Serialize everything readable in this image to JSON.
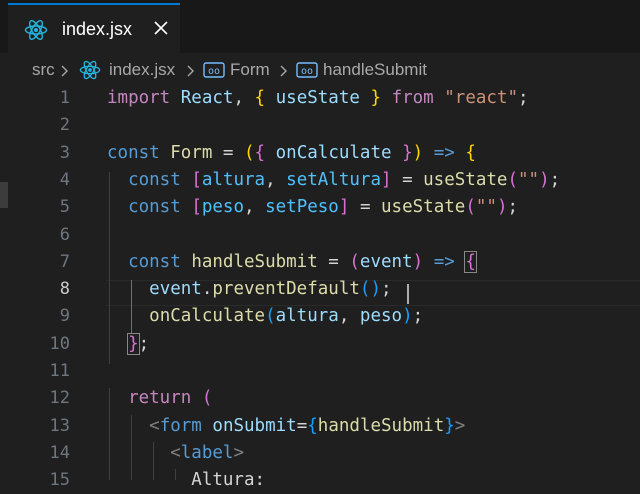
{
  "tab": {
    "filename": "index.jsx",
    "close_label": "close-tab"
  },
  "breadcrumb": {
    "root": "src",
    "file": "index.jsx",
    "component": "Form",
    "symbol": "handleSubmit"
  },
  "editor": {
    "active_line": 8,
    "line_numbers": [
      "1",
      "2",
      "3",
      "4",
      "5",
      "6",
      "7",
      "8",
      "9",
      "10",
      "11",
      "12",
      "13",
      "14",
      "15"
    ],
    "lines": [
      [
        [
          "kw2",
          "import"
        ],
        [
          "d",
          " "
        ],
        [
          "v",
          "React"
        ],
        [
          "d",
          ", "
        ],
        [
          "b1",
          "{"
        ],
        [
          "d",
          " "
        ],
        [
          "v",
          "useState"
        ],
        [
          "d",
          " "
        ],
        [
          "b1",
          "}"
        ],
        [
          "d",
          " "
        ],
        [
          "kw2",
          "from"
        ],
        [
          "d",
          " "
        ],
        [
          "s",
          "\"react\""
        ],
        [
          "d",
          ";"
        ]
      ],
      [],
      [
        [
          "kw",
          "const"
        ],
        [
          "d",
          " "
        ],
        [
          "f",
          "Form"
        ],
        [
          "d",
          " = "
        ],
        [
          "b1",
          "("
        ],
        [
          "b2",
          "{"
        ],
        [
          "d",
          " "
        ],
        [
          "v",
          "onCalculate"
        ],
        [
          "d",
          " "
        ],
        [
          "b2",
          "}"
        ],
        [
          "b1",
          ")"
        ],
        [
          "d",
          " "
        ],
        [
          "kw",
          "=>"
        ],
        [
          "d",
          " "
        ],
        [
          "b1",
          "{"
        ]
      ],
      [
        [
          "d",
          "  "
        ],
        [
          "kw",
          "const"
        ],
        [
          "d",
          " "
        ],
        [
          "b2",
          "["
        ],
        [
          "c",
          "altura"
        ],
        [
          "d",
          ", "
        ],
        [
          "c",
          "setAltura"
        ],
        [
          "b2",
          "]"
        ],
        [
          "d",
          " = "
        ],
        [
          "f",
          "useState"
        ],
        [
          "b2",
          "("
        ],
        [
          "s",
          "\"\""
        ],
        [
          "b2",
          ")"
        ],
        [
          "d",
          ";"
        ]
      ],
      [
        [
          "d",
          "  "
        ],
        [
          "kw",
          "const"
        ],
        [
          "d",
          " "
        ],
        [
          "b2",
          "["
        ],
        [
          "c",
          "peso"
        ],
        [
          "d",
          ", "
        ],
        [
          "c",
          "setPeso"
        ],
        [
          "b2",
          "]"
        ],
        [
          "d",
          " = "
        ],
        [
          "f",
          "useState"
        ],
        [
          "b2",
          "("
        ],
        [
          "s",
          "\"\""
        ],
        [
          "b2",
          ")"
        ],
        [
          "d",
          ";"
        ]
      ],
      [],
      [
        [
          "d",
          "  "
        ],
        [
          "kw",
          "const"
        ],
        [
          "d",
          " "
        ],
        [
          "f",
          "handleSubmit"
        ],
        [
          "d",
          " = "
        ],
        [
          "b2",
          "("
        ],
        [
          "v",
          "event"
        ],
        [
          "b2",
          ")"
        ],
        [
          "d",
          " "
        ],
        [
          "kw",
          "=>"
        ],
        [
          "d",
          " "
        ],
        [
          "b2bm",
          "{"
        ]
      ],
      [
        [
          "d",
          "    "
        ],
        [
          "v",
          "event"
        ],
        [
          "d",
          "."
        ],
        [
          "f",
          "preventDefault"
        ],
        [
          "b3",
          "()"
        ],
        [
          "d",
          ";"
        ]
      ],
      [
        [
          "d",
          "    "
        ],
        [
          "f",
          "onCalculate"
        ],
        [
          "b3",
          "("
        ],
        [
          "v",
          "altura"
        ],
        [
          "d",
          ", "
        ],
        [
          "v",
          "peso"
        ],
        [
          "b3",
          ")"
        ],
        [
          "d",
          ";"
        ]
      ],
      [
        [
          "d",
          "  "
        ],
        [
          "b2bm",
          "}"
        ],
        [
          "d",
          ";"
        ]
      ],
      [],
      [
        [
          "d",
          "  "
        ],
        [
          "kw2",
          "return"
        ],
        [
          "d",
          " "
        ],
        [
          "b2",
          "("
        ]
      ],
      [
        [
          "d",
          "    "
        ],
        [
          "p",
          "<"
        ],
        [
          "tg",
          "form"
        ],
        [
          "d",
          " "
        ],
        [
          "v",
          "onSubmit"
        ],
        [
          "d",
          "="
        ],
        [
          "b3",
          "{"
        ],
        [
          "f",
          "handleSubmit"
        ],
        [
          "b3",
          "}"
        ],
        [
          "p",
          ">"
        ]
      ],
      [
        [
          "d",
          "      "
        ],
        [
          "p",
          "<"
        ],
        [
          "tg",
          "label"
        ],
        [
          "p",
          ">"
        ]
      ],
      [
        [
          "d",
          "        Altura:"
        ]
      ]
    ]
  }
}
